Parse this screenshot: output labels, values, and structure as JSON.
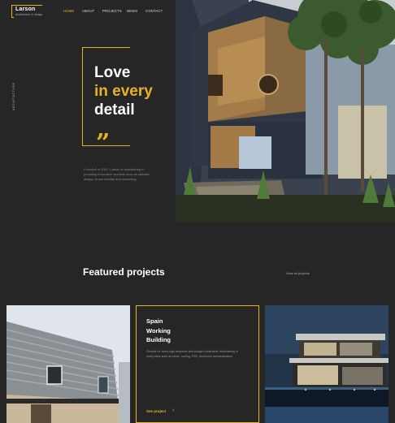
{
  "brand": {
    "name": "Larson",
    "tagline": "Architecture & design"
  },
  "nav": {
    "items": [
      {
        "label": "HOME",
        "active": true
      },
      {
        "label": "ABOUT",
        "active": false
      },
      {
        "label": "PROJECTS",
        "active": false
      },
      {
        "label": "NEWS",
        "active": false
      },
      {
        "label": "CONTACT",
        "active": false
      }
    ]
  },
  "hero": {
    "side_label": "ARCHITECTURE",
    "line1": "Love",
    "line2": "in every",
    "line3": "detail",
    "quote_mark": "”",
    "intro": "Founded in 2007, Larson is specializing in providing innovative services such as website design, brand   identity and marketing."
  },
  "featured": {
    "title": "Featured projects",
    "view_all": "View all projects",
    "card": {
      "title_l1": "Spain",
      "title_l2": "Working",
      "title_l3": "Building",
      "text": "Flexible for every logo demands and budget constraints, entertaining in many skills such as stone, roofing, PSD, aluminum communication.",
      "link": "See project",
      "arrow": "›"
    }
  },
  "colors": {
    "accent": "#e7b321",
    "background": "#262626"
  }
}
